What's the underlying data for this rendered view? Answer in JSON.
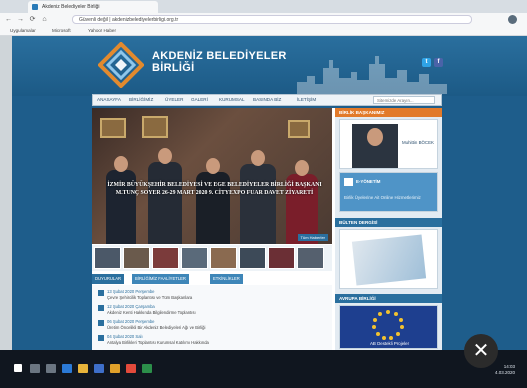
{
  "browser": {
    "tab_title": "Akdeniz Belediyeler Birliği",
    "url": "Güvenli değil | akdenizbelediyelerbirligi.org.tr",
    "bookmarks": [
      "Uygulamalar",
      "Microsoft",
      "Yahoo! Haber"
    ],
    "nav": {
      "back": "←",
      "forward": "→",
      "reload": "⟳",
      "home": "⌂"
    }
  },
  "site": {
    "logo_line1": "AKDENİZ BELEDİYELER",
    "logo_line2": "BİRLİĞİ",
    "brand_color": "#1e5d8b",
    "social": {
      "twitter": "t",
      "facebook": "f"
    },
    "menu": [
      "ANASAYFA",
      "BİRLİĞİMİZ",
      "ÜYELER",
      "GALERİ",
      "KURUMSAL",
      "BASINDA BİZ",
      "İLETİŞİM"
    ],
    "search_placeholder": "Sitemizde Arayın..."
  },
  "slider": {
    "caption": "İZMİR BÜYÜKŞEHİR BELEDİYESİ VE EGE BELEDİYELER BİRLİĞİ BAŞKANI M.TUNÇ SOYER 26-29 MART 2020 9. CİTYEXPO FUAR DAVET ZİYARETİ",
    "all_news": "Tüm Haberler"
  },
  "content_tabs": [
    "DUYURULAR",
    "BİRLİĞİMİZ FAALİYETLER",
    "ETKİNLİKLER"
  ],
  "news": [
    {
      "date": "13 Şubat 2020 Perşembe",
      "title": "Çevre Şehircilik Toplantısı ve Tüm Başkanlara"
    },
    {
      "date": "12 Şubat 2020 Çarşamba",
      "title": "Akdeniz Kenti Hakkında Bilgilendirme Toplantısı"
    },
    {
      "date": "06 Şubat 2020 Perşembe",
      "title": "Üretim Öncelikli Bir Akdeniz Belediyeleri Ağı ve Birliği"
    },
    {
      "date": "04 Şubat 2020 Salı",
      "title": "Antalya Birlikleri Toplantısı Kurumsal Katılımı Hakkında"
    }
  ],
  "sidebar": {
    "president_header": "BİRLİK BAŞKANIMIZ",
    "president_label": "Muhittin BÖCEK",
    "eoffice_header": "E-YÖNETİM",
    "eoffice_label": "Birlik Üyelerine Ait Online Hizmetlerimiz",
    "bulletin_header": "BÜLTEN DERGİSİ",
    "eu_header": "AVRUPA BİRLİĞİ",
    "eu_label": "AB Destekli Projeler"
  },
  "taskbar": {
    "time": "14:03",
    "date": "4.03.2020"
  }
}
